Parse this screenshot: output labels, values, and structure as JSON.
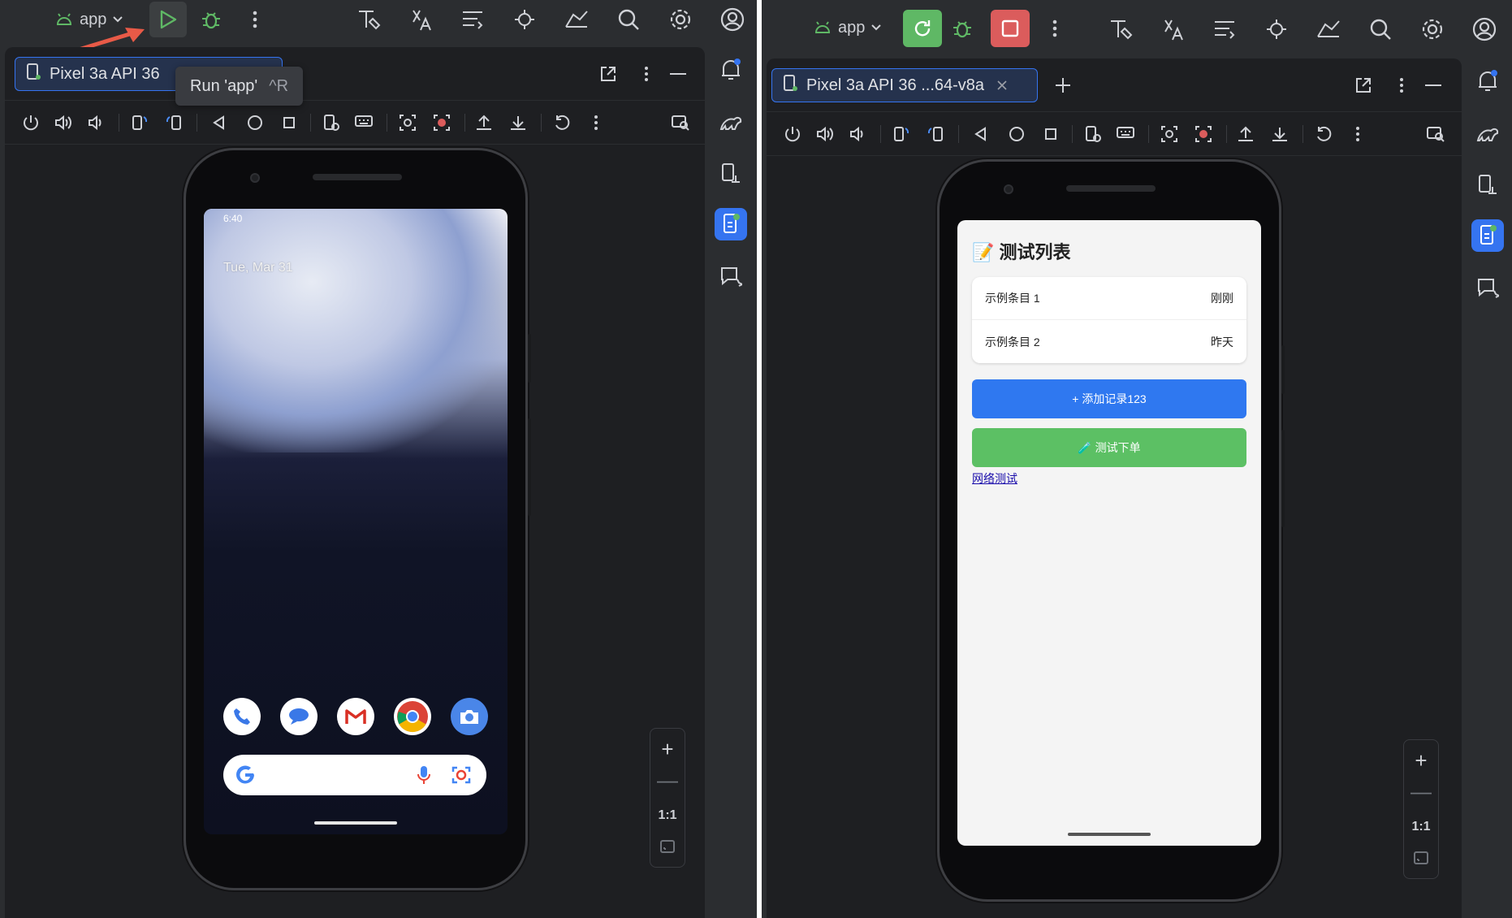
{
  "left": {
    "toolbar": {
      "config": "app",
      "run_tooltip": "Run 'app'",
      "run_shortcut": "^R"
    },
    "tab": {
      "label": "Pixel 3a API 36"
    },
    "device": {
      "status_time": "6:40",
      "date": "Tue, Mar 31",
      "dock_apps": [
        "phone-icon",
        "messages-icon",
        "gmail-icon",
        "chrome-icon",
        "camera-icon"
      ]
    },
    "zoom": {
      "ratio": "1:1"
    }
  },
  "right": {
    "toolbar": {
      "config": "app"
    },
    "tab": {
      "label": "Pixel 3a API 36 ...64-v8a"
    },
    "app": {
      "title": "📝 测试列表",
      "items": [
        {
          "name": "示例条目 1",
          "time": "刚刚"
        },
        {
          "name": "示例条目 2",
          "time": "昨天"
        }
      ],
      "add_button": "+ 添加记录123",
      "order_button": "🧪 测试下单",
      "network_link": "网络测试"
    },
    "zoom": {
      "ratio": "1:1"
    }
  },
  "colors": {
    "ide_bg": "#2b2d30",
    "editor_bg": "#1e1f22",
    "accent_blue": "#3574f0",
    "run_green": "#5fb865",
    "stop_red": "#db5c5c",
    "add_button": "#2f78f0",
    "order_button": "#5cc064",
    "arrow": "#e85a47"
  }
}
